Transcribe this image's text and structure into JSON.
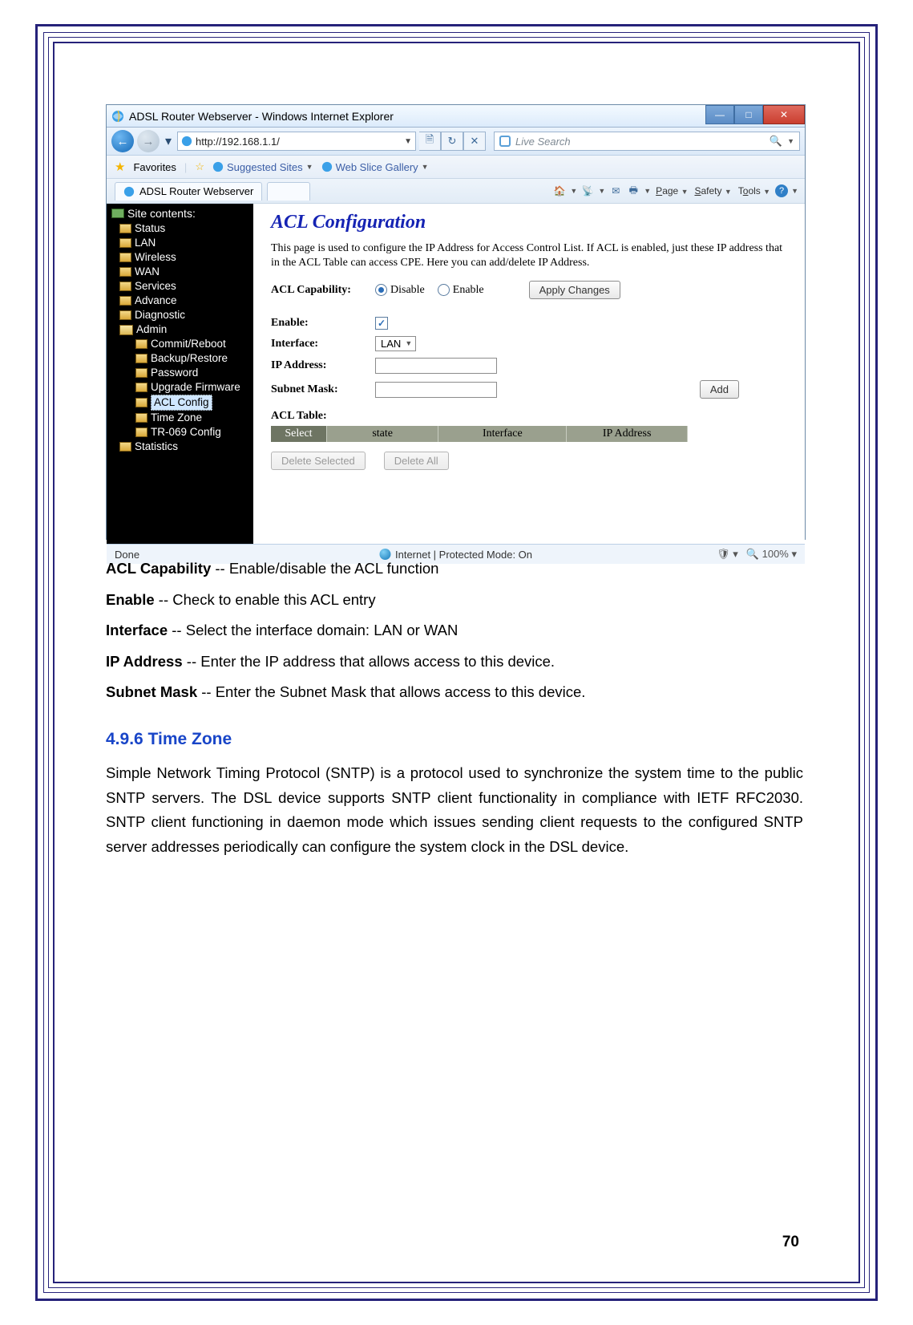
{
  "browser": {
    "window_title": "ADSL Router Webserver - Windows Internet Explorer",
    "url": "http://192.168.1.1/",
    "search_placeholder": "Live Search",
    "fav_label": "Favorites",
    "suggested": "Suggested Sites",
    "webslice": "Web Slice Gallery",
    "tab_title": "ADSL Router Webserver",
    "toolbar": {
      "page": "Page",
      "safety": "Safety",
      "tools": "Tools"
    },
    "status_left": "Done",
    "status_center": "Internet | Protected Mode: On",
    "zoom": "100%"
  },
  "sidebar": {
    "title": "Site contents:",
    "items": [
      "Status",
      "LAN",
      "Wireless",
      "WAN",
      "Services",
      "Advance",
      "Diagnostic"
    ],
    "admin_label": "Admin",
    "admin_children": [
      "Commit/Reboot",
      "Backup/Restore",
      "Password",
      "Upgrade Firmware",
      "ACL Config",
      "Time Zone",
      "TR-069 Config"
    ],
    "last": "Statistics",
    "selected": "ACL Config"
  },
  "acl": {
    "heading": "ACL Configuration",
    "desc": "This page is used to configure the IP Address for Access Control List. If ACL is enabled, just these IP address that in the ACL Table can access CPE. Here you can add/delete IP Address.",
    "cap_label": "ACL Capability:",
    "opt_disable": "Disable",
    "opt_enable": "Enable",
    "apply": "Apply Changes",
    "enable_label": "Enable:",
    "iface_label": "Interface:",
    "iface_value": "LAN",
    "ip_label": "IP Address:",
    "mask_label": "Subnet Mask:",
    "add": "Add",
    "table_label": "ACL Table:",
    "cols": [
      "Select",
      "state",
      "Interface",
      "IP Address"
    ],
    "del_sel": "Delete Selected",
    "del_all": "Delete All"
  },
  "notes": {
    "n1a": "ACL Capability",
    "n1b": " -- Enable/disable the ACL function",
    "n2a": "Enable",
    "n2b": " -- Check to enable this ACL entry",
    "n3a": "Interface",
    "n3b": " -- Select the interface domain: LAN or WAN",
    "n4a": "IP Address",
    "n4b": " -- Enter the IP address that allows access to this device.",
    "n5a": "Subnet Mask",
    "n5b": " -- Enter the Subnet Mask that allows access to this device."
  },
  "section": {
    "heading": "4.9.6 Time Zone",
    "body": "Simple Network Timing Protocol (SNTP) is a protocol used to synchronize the system time to the public SNTP servers. The DSL device supports SNTP client functionality in compliance with IETF RFC2030. SNTP client functioning in daemon mode which issues sending client requests to the configured SNTP server addresses periodically can configure the system clock in the DSL device."
  },
  "page_number": "70"
}
